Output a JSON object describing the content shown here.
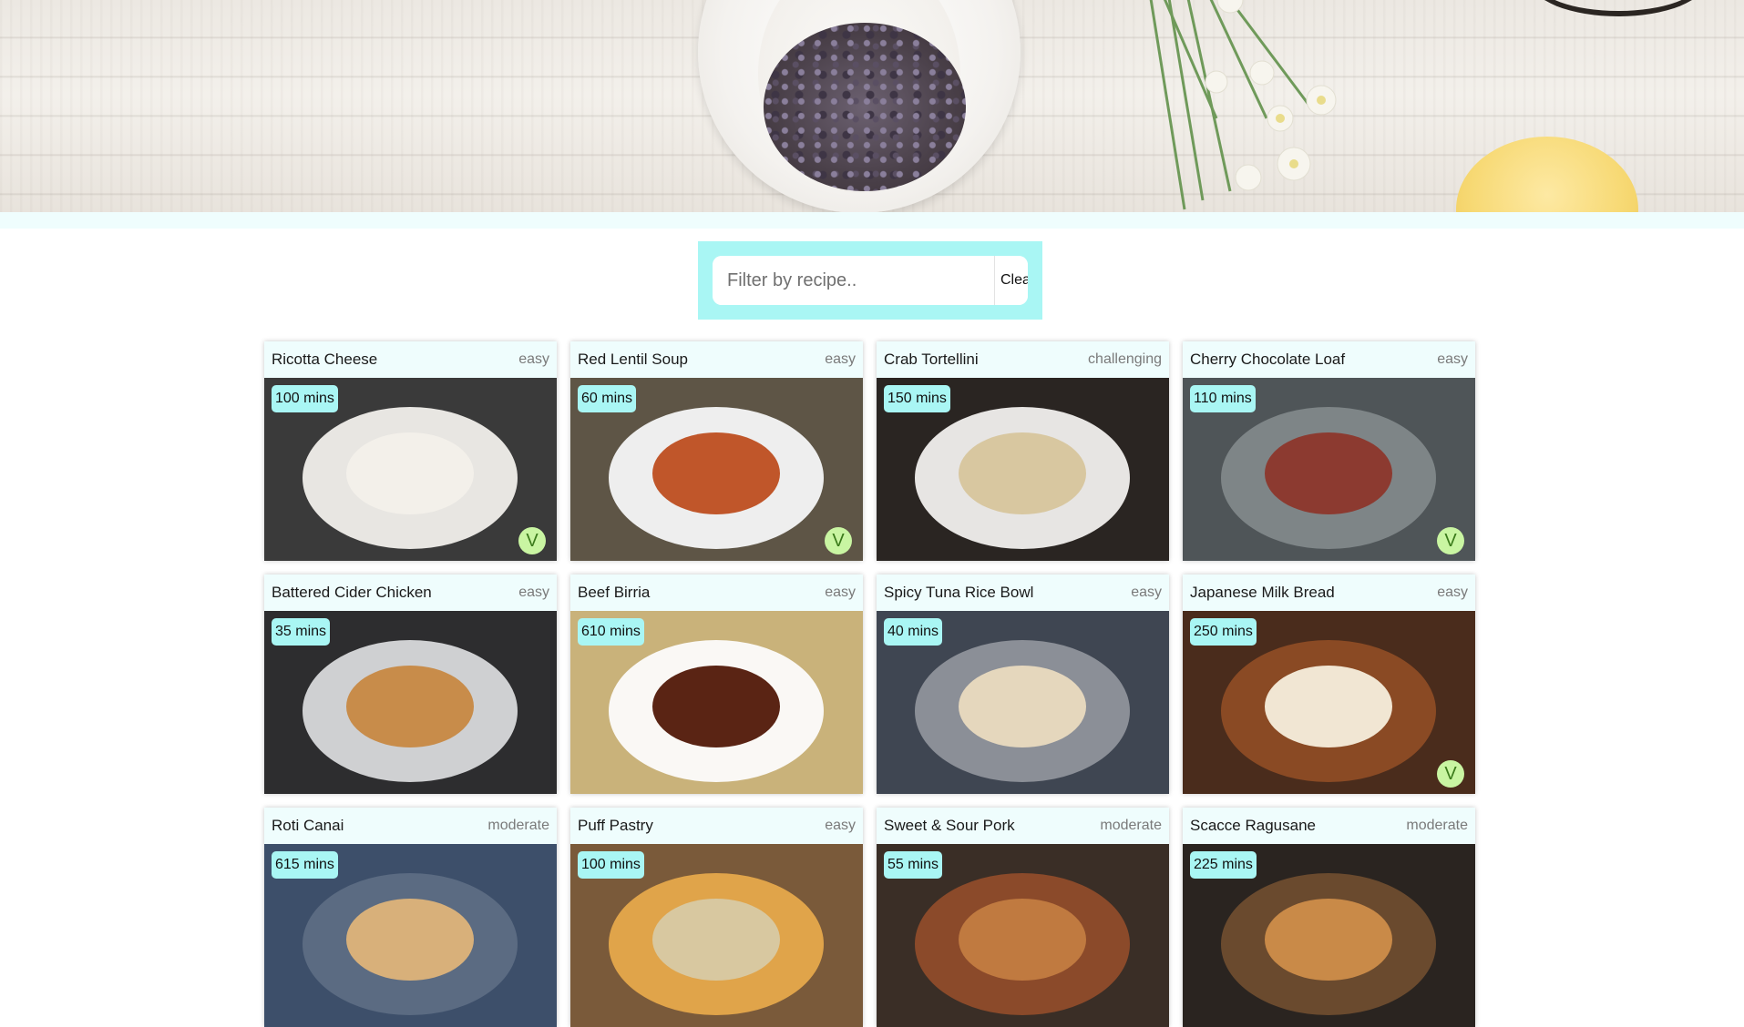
{
  "filter": {
    "placeholder": "Filter by recipe..",
    "clear_label": "Clear"
  },
  "recipes": [
    {
      "title": "Ricotta Cheese",
      "difficulty": "easy",
      "time": "100 mins",
      "veg": "V",
      "palette": [
        "#3a3a3a",
        "#e8e6e2",
        "#f3f0ea"
      ]
    },
    {
      "title": "Red Lentil Soup",
      "difficulty": "easy",
      "time": "60 mins",
      "veg": "V",
      "palette": [
        "#5e5546",
        "#eeeeee",
        "#c0562a"
      ]
    },
    {
      "title": "Crab Tortellini",
      "difficulty": "challenging",
      "time": "150 mins",
      "palette": [
        "#2a2522",
        "#e7e5e3",
        "#d8c7a0"
      ]
    },
    {
      "title": "Cherry Chocolate Loaf",
      "difficulty": "easy",
      "time": "110 mins",
      "veg": "V",
      "palette": [
        "#4f5558",
        "#7e8587",
        "#8c3a30"
      ]
    },
    {
      "title": "Battered Cider Chicken",
      "difficulty": "easy",
      "time": "35 mins",
      "palette": [
        "#2d2d2f",
        "#cfd0d2",
        "#c88c4a"
      ]
    },
    {
      "title": "Beef Birria",
      "difficulty": "easy",
      "time": "610 mins",
      "palette": [
        "#c9b27a",
        "#faf8f5",
        "#5a2414"
      ]
    },
    {
      "title": "Spicy Tuna Rice Bowl",
      "difficulty": "easy",
      "time": "40 mins",
      "palette": [
        "#3f4652",
        "#8b8f97",
        "#e5d7bd"
      ]
    },
    {
      "title": "Japanese Milk Bread",
      "difficulty": "easy",
      "time": "250 mins",
      "veg": "V",
      "palette": [
        "#4a2c1c",
        "#8a4a24",
        "#f1e6d3"
      ]
    },
    {
      "title": "Roti Canai",
      "difficulty": "moderate",
      "time": "615 mins",
      "palette": [
        "#3d4f6a",
        "#5b6b82",
        "#d8b07a"
      ]
    },
    {
      "title": "Puff Pastry",
      "difficulty": "easy",
      "time": "100 mins",
      "palette": [
        "#7a5a3a",
        "#e0a44a",
        "#d8c8a0"
      ]
    },
    {
      "title": "Sweet & Sour Pork",
      "difficulty": "moderate",
      "time": "55 mins",
      "palette": [
        "#3a2e26",
        "#8b4a2a",
        "#c07a40"
      ]
    },
    {
      "title": "Scacce Ragusane",
      "difficulty": "moderate",
      "time": "225 mins",
      "palette": [
        "#2a2420",
        "#6a4a2e",
        "#c98a48"
      ]
    }
  ]
}
